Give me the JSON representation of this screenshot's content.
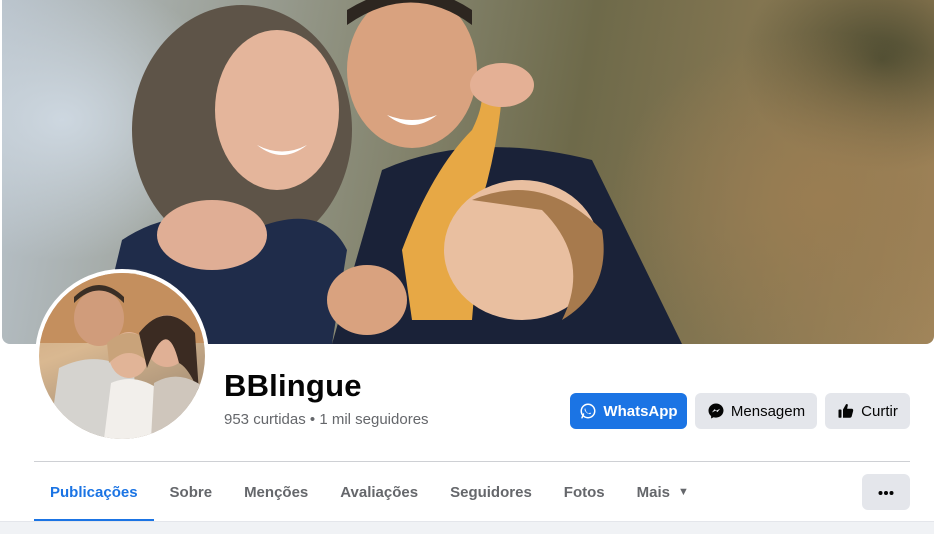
{
  "page": {
    "name": "BBlingue",
    "likes": "953 curtidas",
    "separator": " • ",
    "followers": "1 mil seguidores"
  },
  "actions": {
    "whatsapp_label": "WhatsApp",
    "message_label": "Mensagem",
    "like_label": "Curtir"
  },
  "tabs": [
    {
      "label": "Publicações",
      "active": true
    },
    {
      "label": "Sobre"
    },
    {
      "label": "Menções"
    },
    {
      "label": "Avaliações"
    },
    {
      "label": "Seguidores"
    },
    {
      "label": "Fotos"
    },
    {
      "label": "Mais"
    }
  ],
  "icons": {
    "whatsapp": "whatsapp-icon",
    "messenger": "messenger-icon",
    "like": "thumbs-up-icon",
    "more": "ellipsis-icon",
    "caret": "caret-down-icon"
  },
  "colors": {
    "accent": "#1b74e4",
    "button_gray": "#e4e6eb",
    "secondary_text": "#65676b"
  }
}
